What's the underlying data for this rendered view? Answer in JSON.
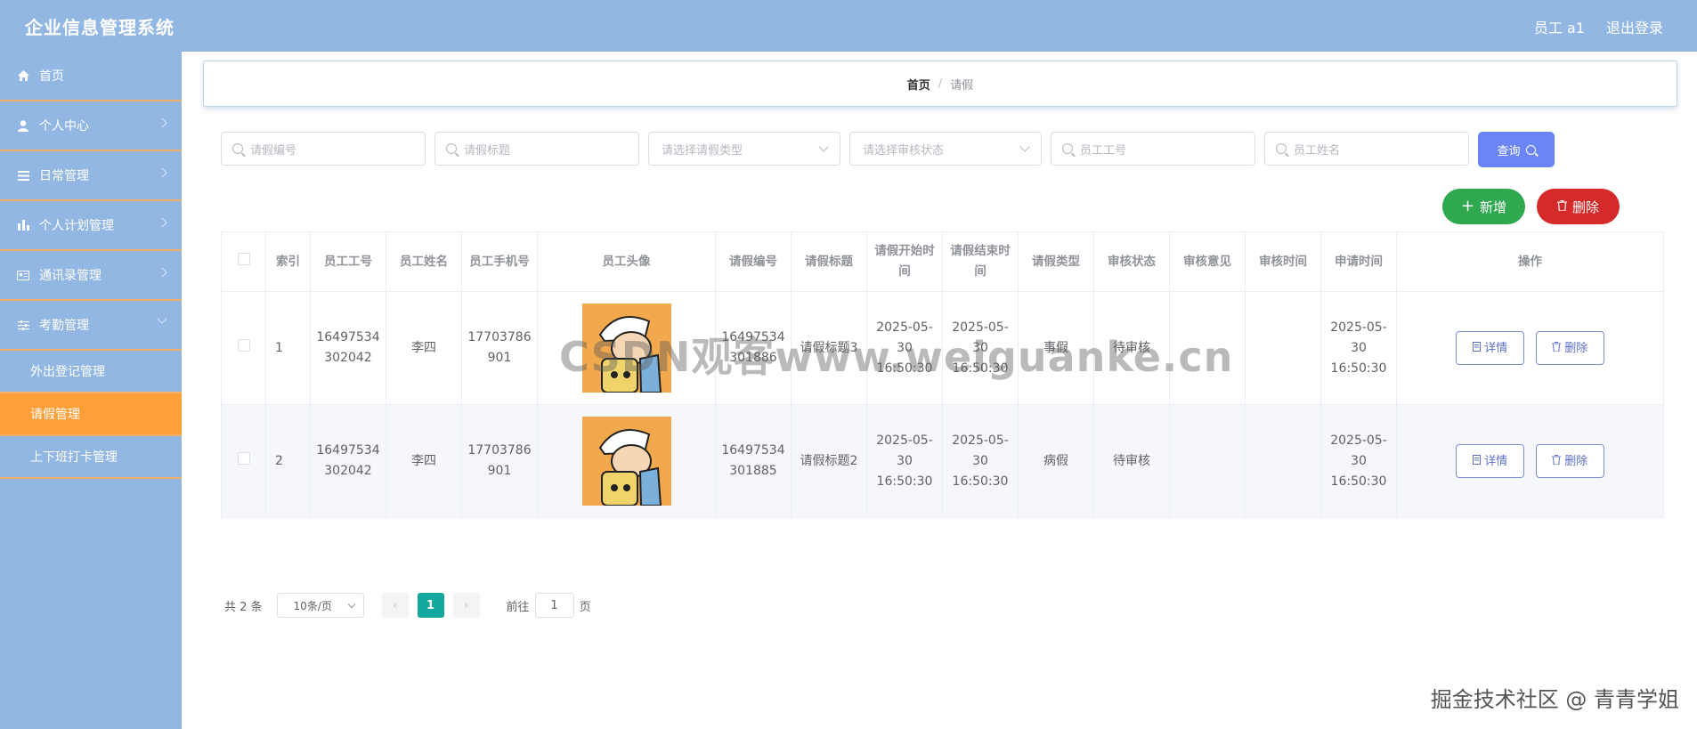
{
  "header": {
    "app_title": "企业信息管理系统",
    "user_label": "员工 a1",
    "logout_label": "退出登录"
  },
  "sidebar": {
    "items": [
      {
        "label": "首页",
        "icon": "home-icon"
      },
      {
        "label": "个人中心",
        "icon": "user-icon"
      },
      {
        "label": "日常管理",
        "icon": "list-icon"
      },
      {
        "label": "个人计划管理",
        "icon": "chart-icon"
      },
      {
        "label": "通讯录管理",
        "icon": "contact-icon"
      },
      {
        "label": "考勤管理",
        "icon": "sliders-icon"
      }
    ],
    "sub_items": [
      {
        "label": "外出登记管理"
      },
      {
        "label": "请假管理",
        "active": true
      },
      {
        "label": "上下班打卡管理"
      }
    ]
  },
  "breadcrumb": {
    "home": "首页",
    "separator": "/",
    "current": "请假"
  },
  "search": {
    "leave_no_placeholder": "请假编号",
    "leave_title_placeholder": "请假标题",
    "leave_type_placeholder": "请选择请假类型",
    "audit_status_placeholder": "请选择审核状态",
    "emp_no_placeholder": "员工工号",
    "emp_name_placeholder": "员工姓名",
    "query_label": "查询"
  },
  "actions": {
    "add_label": "新增",
    "delete_label": "删除"
  },
  "table": {
    "headers": [
      "索引",
      "员工工号",
      "员工姓名",
      "员工手机号",
      "员工头像",
      "请假编号",
      "请假标题",
      "请假开始时间",
      "请假结束时间",
      "请假类型",
      "审核状态",
      "审核意见",
      "审核时间",
      "申请时间",
      "操作"
    ],
    "rows": [
      {
        "index": "1",
        "emp_no": "16497534302042",
        "emp_name": "李四",
        "phone": "17703786901",
        "leave_no": "16497534301886",
        "leave_title": "请假标题3",
        "start": "2025-05-30 16:50:30",
        "end": "2025-05-30 16:50:30",
        "type": "事假",
        "status": "待审核",
        "opinion": "",
        "audit_time": "",
        "apply_time": "2025-05-30 16:50:30"
      },
      {
        "index": "2",
        "emp_no": "16497534302042",
        "emp_name": "李四",
        "phone": "17703786901",
        "leave_no": "16497534301885",
        "leave_title": "请假标题2",
        "start": "2025-05-30 16:50:30",
        "end": "2025-05-30 16:50:30",
        "type": "病假",
        "status": "待审核",
        "opinion": "",
        "audit_time": "",
        "apply_time": "2025-05-30 16:50:30"
      }
    ],
    "detail_label": "详情",
    "row_delete_label": "删除"
  },
  "pager": {
    "total_text": "共 2 条",
    "page_size": "10条/页",
    "current_page": "1",
    "goto_prefix": "前往",
    "goto_value": "1",
    "goto_suffix": "页"
  },
  "watermarks": {
    "center": "CSDN观客www.weiguanke.cn",
    "corner": "掘金技术社区 @ 青青学姐"
  },
  "colors": {
    "header_bg": "#93b7e3",
    "active_menu": "#ff9f3a",
    "menu_divider": "#f7b06a",
    "query_btn": "#6b85f7",
    "add_btn": "#2fa84f",
    "delete_btn": "#d42a2a",
    "page_active": "#13a89e"
  }
}
